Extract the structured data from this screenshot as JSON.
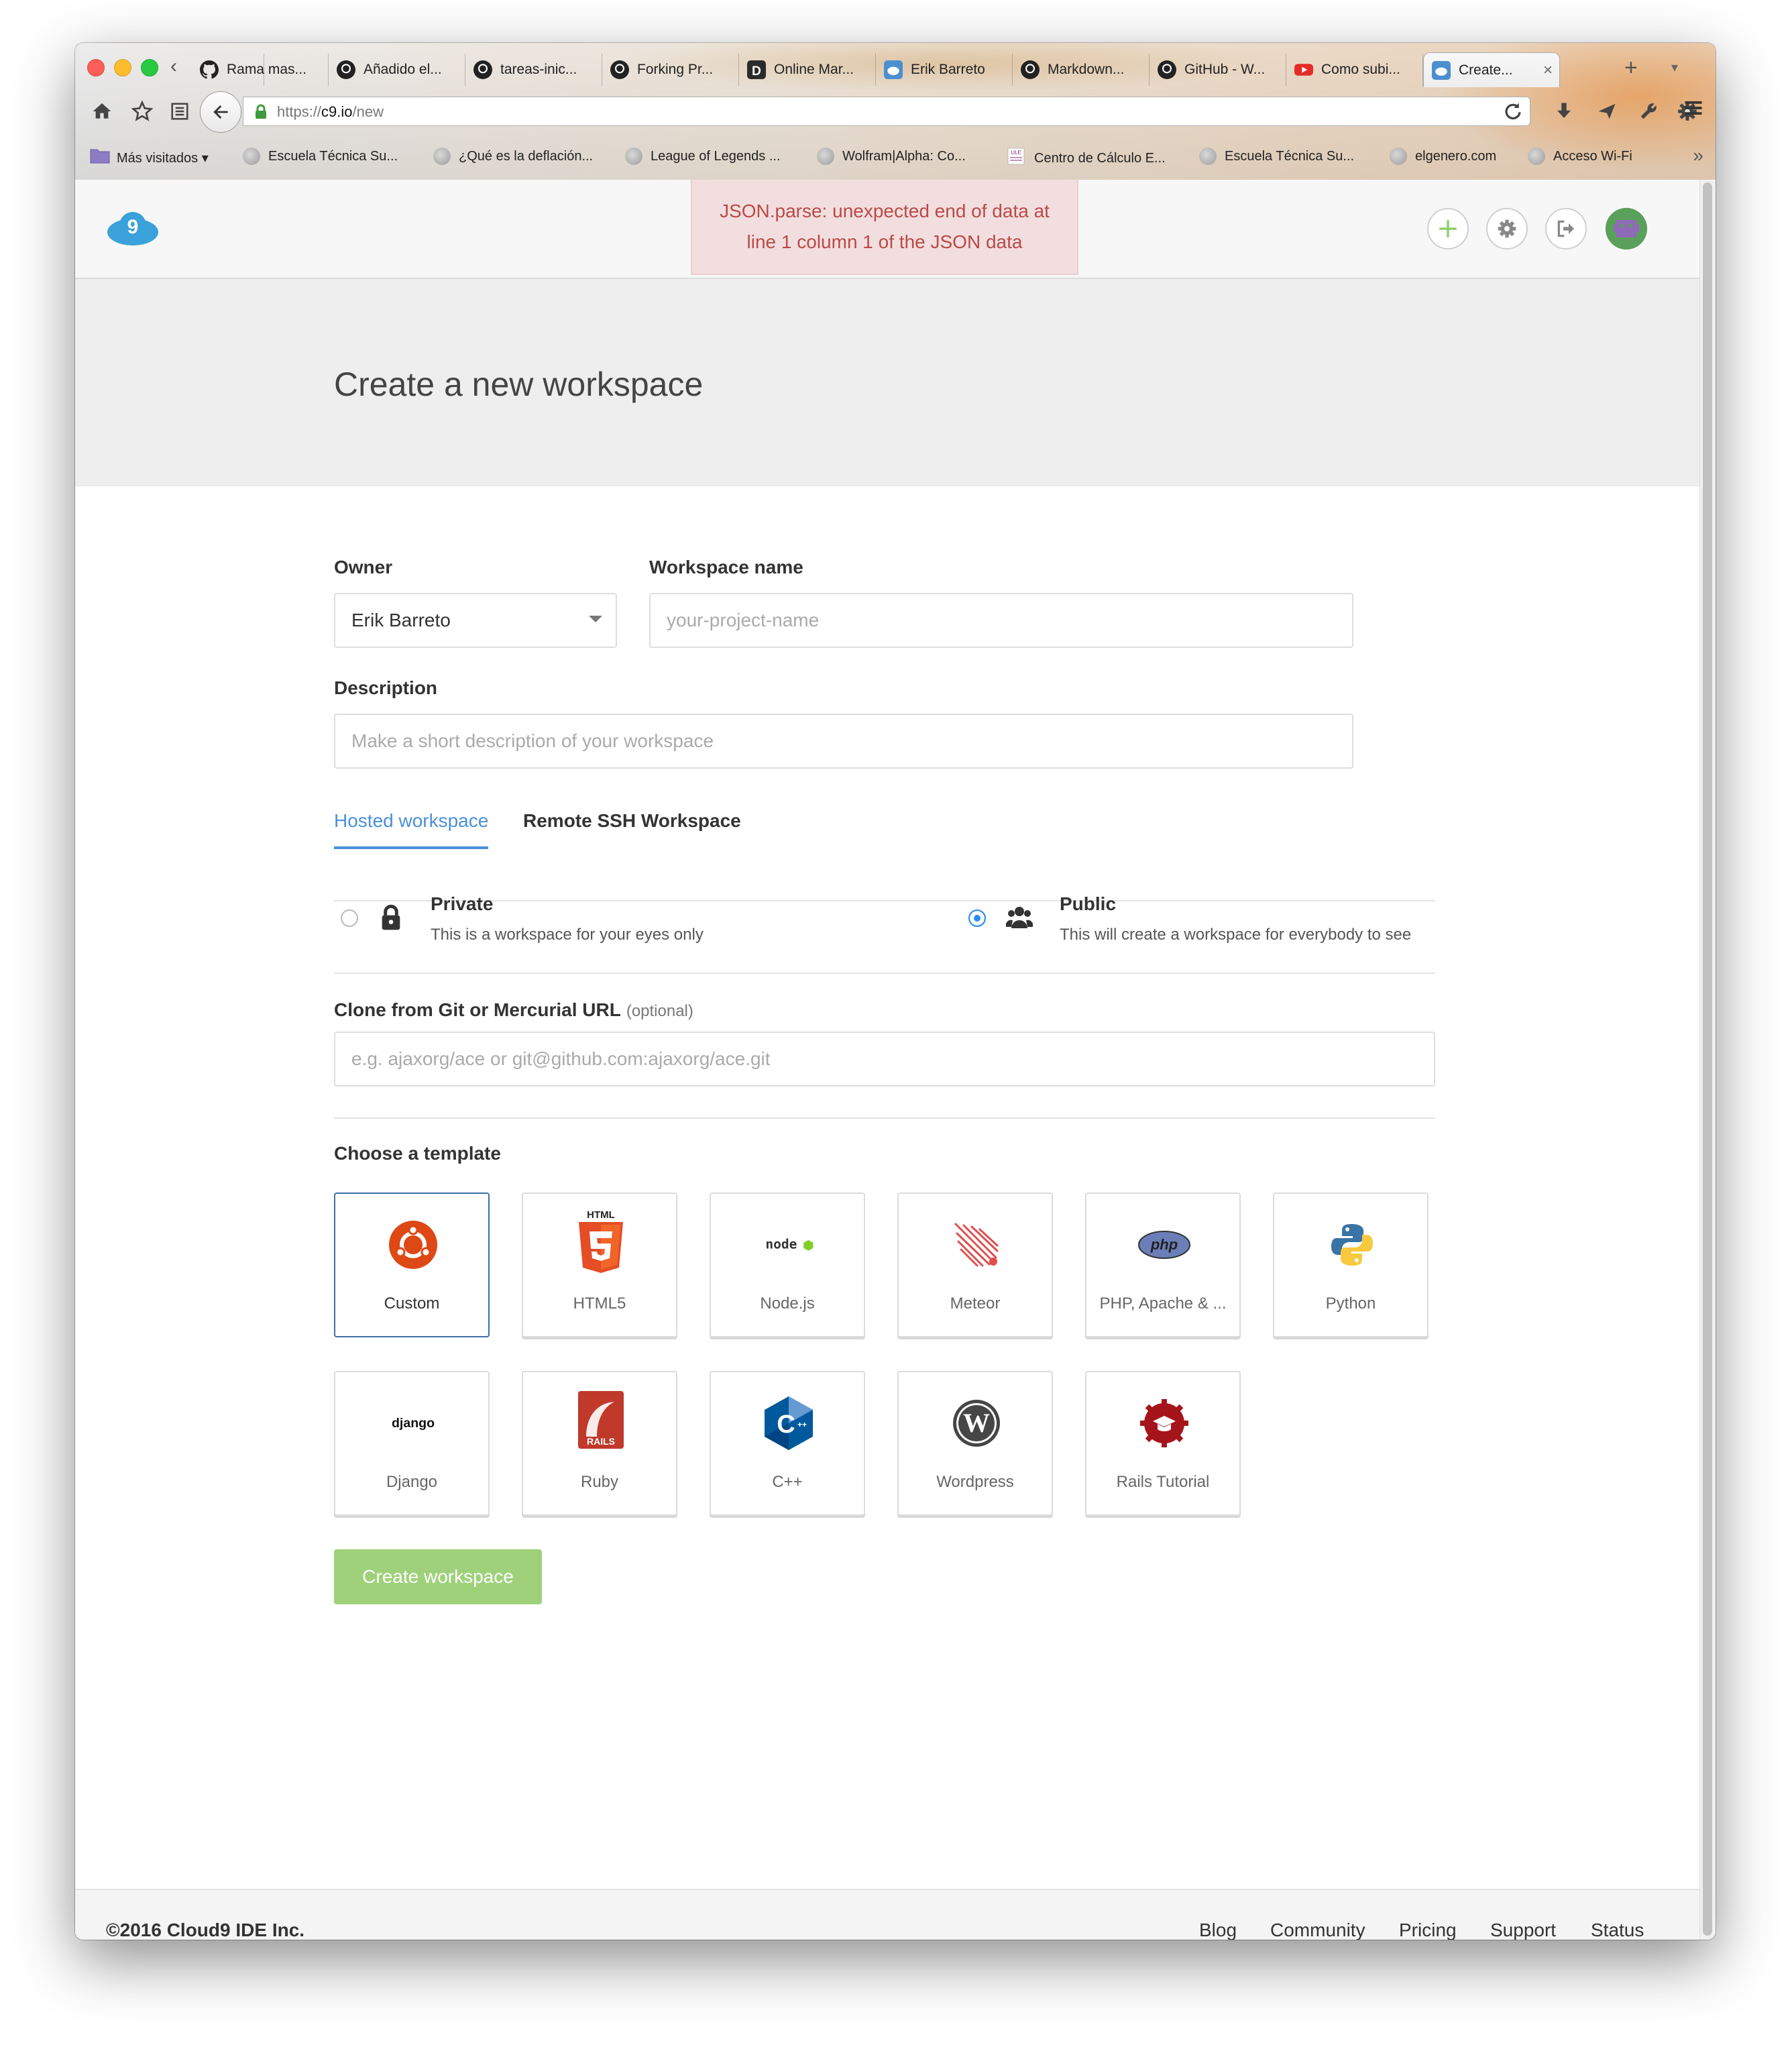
{
  "browser": {
    "tabs": [
      {
        "label": "Rama mas...",
        "icon": "github-icon"
      },
      {
        "label": "Añadido el...",
        "icon": "github-icon"
      },
      {
        "label": "tareas-inic...",
        "icon": "github-icon"
      },
      {
        "label": "Forking Pr...",
        "icon": "github-icon"
      },
      {
        "label": "Online Mar...",
        "icon": "dillinger-icon"
      },
      {
        "label": "Erik Barreto",
        "icon": "cloud9-icon"
      },
      {
        "label": "Markdown...",
        "icon": "github-icon"
      },
      {
        "label": "GitHub - W...",
        "icon": "github-icon"
      },
      {
        "label": "Como subi...",
        "icon": "youtube-icon"
      },
      {
        "label": "Create...",
        "icon": "cloud9-icon",
        "active": true
      }
    ],
    "url_scheme": "https://",
    "url_host": "c9.io",
    "url_path": "/new",
    "bookmarks": [
      {
        "label": "Más visitados ▾",
        "icon": "folder-icon"
      },
      {
        "label": "Escuela Técnica Su...",
        "icon": "globe-icon"
      },
      {
        "label": "¿Qué es la deflación...",
        "icon": "globe-icon"
      },
      {
        "label": "League of Legends ...",
        "icon": "globe-icon"
      },
      {
        "label": "Wolfram|Alpha: Co...",
        "icon": "globe-icon"
      },
      {
        "label": "Centro de Cálculo E...",
        "icon": "ule-icon"
      },
      {
        "label": "Escuela Técnica Su...",
        "icon": "globe-icon"
      },
      {
        "label": "elgenero.com",
        "icon": "globe-icon"
      },
      {
        "label": "Acceso Wi-Fi",
        "icon": "globe-icon"
      }
    ]
  },
  "header": {
    "error_line1": "JSON.parse: unexpected end of data at",
    "error_line2": "line 1 column 1 of the JSON data",
    "logo": "cloud9-logo",
    "logo_digit": "9"
  },
  "page": {
    "title": "Create a new workspace"
  },
  "form": {
    "owner_label": "Owner",
    "owner_value": "Erik Barreto",
    "name_label": "Workspace name",
    "name_placeholder": "your-project-name",
    "description_label": "Description",
    "description_placeholder": "Make a short description of your workspace",
    "tabs": {
      "hosted": "Hosted workspace",
      "remote": "Remote SSH Workspace"
    },
    "private_title": "Private",
    "private_desc": "This is a workspace for your eyes only",
    "public_title": "Public",
    "public_desc": "This will create a workspace for everybody to see",
    "selected_visibility": "public",
    "clone_label": "Clone from Git or Mercurial URL",
    "clone_optional": "(optional)",
    "clone_placeholder": "e.g. ajaxorg/ace or git@github.com:ajaxorg/ace.git",
    "template_label": "Choose a template",
    "templates": [
      {
        "label": "Custom",
        "icon": "ubuntu-icon",
        "selected": true
      },
      {
        "label": "HTML5",
        "icon": "html5-icon",
        "icon_text": "HTML"
      },
      {
        "label": "Node.js",
        "icon": "nodejs-icon",
        "icon_text": "node"
      },
      {
        "label": "Meteor",
        "icon": "meteor-icon"
      },
      {
        "label": "PHP, Apache & ...",
        "icon": "php-icon",
        "icon_text": "php"
      },
      {
        "label": "Python",
        "icon": "python-icon"
      },
      {
        "label": "Django",
        "icon": "django-icon",
        "icon_text": "django"
      },
      {
        "label": "Ruby",
        "icon": "rails-icon",
        "icon_text": "RAILS"
      },
      {
        "label": "C++",
        "icon": "cpp-icon",
        "icon_text": "C"
      },
      {
        "label": "Wordpress",
        "icon": "wordpress-icon",
        "icon_text": "W"
      },
      {
        "label": "Rails Tutorial",
        "icon": "rails-tutorial-icon"
      }
    ],
    "create_button": "Create workspace"
  },
  "footer": {
    "copyright": "©2016  Cloud9 IDE Inc.",
    "links": [
      "Blog",
      "Community",
      "Pricing",
      "Support",
      "Status"
    ]
  },
  "colors": {
    "accent_blue": "#4a90d9",
    "create_button_green": "#9fd17a",
    "error_bg": "#f2dede",
    "error_text": "#b94a48"
  }
}
